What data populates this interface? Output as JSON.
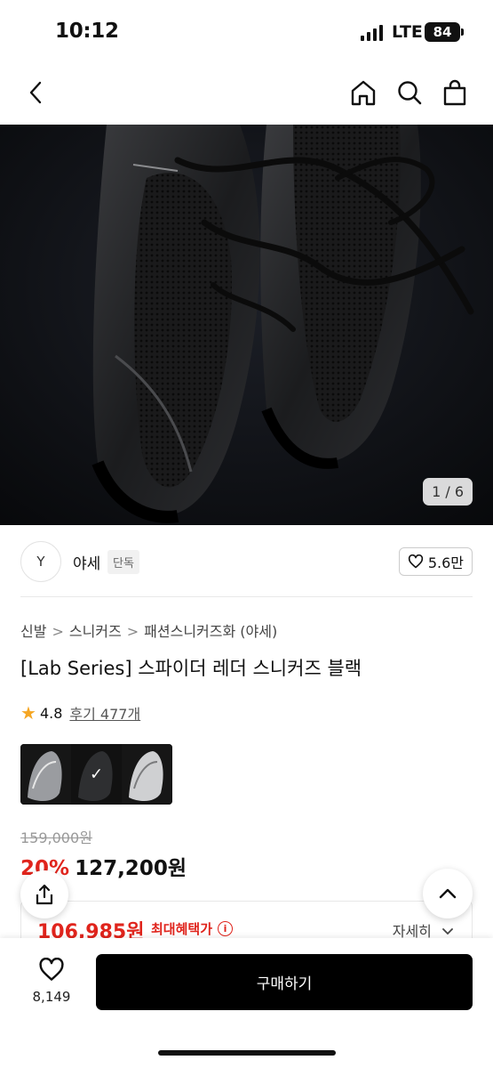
{
  "status": {
    "time": "10:12",
    "network": "LTE",
    "battery": "84"
  },
  "hero": {
    "counter": "1 / 6"
  },
  "seller": {
    "logo": "Y",
    "name": "야세",
    "tag": "단독",
    "likes": "5.6만"
  },
  "breadcrumb": [
    "신발",
    "스니커즈",
    "패션스니커즈화 (야세)"
  ],
  "product": {
    "title": "[Lab Series] 스파이더 레더 스니커즈 블랙",
    "rating": "4.8",
    "reviews": "후기 477개",
    "original_price": "159,000원",
    "discount": "20%",
    "price": "127,200원"
  },
  "benefit": {
    "amount": "106,985원",
    "label": "최대혜택가",
    "more": "자세히"
  },
  "bottom": {
    "wish_count": "8,149",
    "buy_label": "구매하기"
  },
  "colors": {
    "accent_red": "#e0241c",
    "star": "#f5a623",
    "buy_bg": "#000000"
  }
}
